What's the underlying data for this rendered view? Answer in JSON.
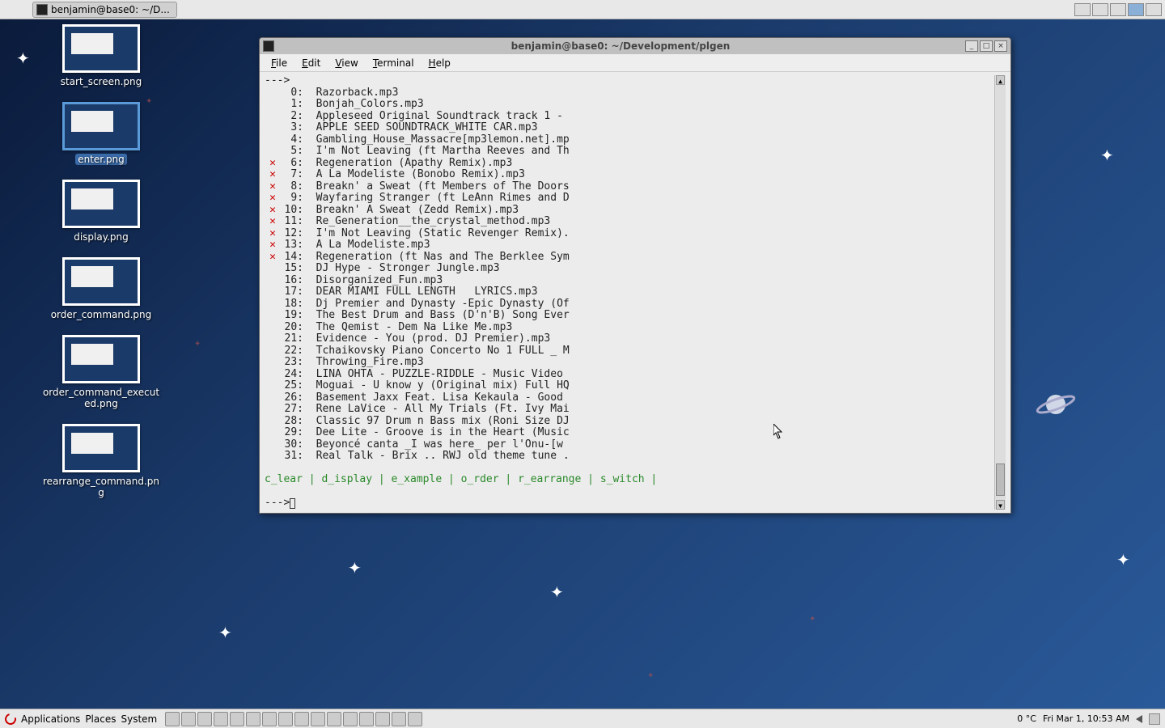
{
  "top_panel": {
    "task_label": "benjamin@base0: ~/D..."
  },
  "bottom_panel": {
    "menus": [
      "Applications",
      "Places",
      "System"
    ],
    "temp": "0 °C",
    "clock": "Fri Mar  1, 10:53 AM"
  },
  "desktop_icons": [
    {
      "label": "start_screen.png",
      "selected": false
    },
    {
      "label": "enter.png",
      "selected": true
    },
    {
      "label": "display.png",
      "selected": false
    },
    {
      "label": "order_command.png",
      "selected": false
    },
    {
      "label": "order_command_executed.png",
      "selected": false
    },
    {
      "label": "rearrange_command.png",
      "selected": false
    }
  ],
  "terminal": {
    "title": "benjamin@base0: ~/Development/plgen",
    "menus": [
      "File",
      "Edit",
      "View",
      "Terminal",
      "Help"
    ],
    "prompt": "--->",
    "tracks": [
      {
        "n": 0,
        "mark": false,
        "t": "Razorback.mp3"
      },
      {
        "n": 1,
        "mark": false,
        "t": "Bonjah_Colors.mp3"
      },
      {
        "n": 2,
        "mark": false,
        "t": "Appleseed Original Soundtrack track 1 -"
      },
      {
        "n": 3,
        "mark": false,
        "t": "APPLE SEED SOUNDTRACK_WHITE CAR.mp3"
      },
      {
        "n": 4,
        "mark": false,
        "t": "Gambling_House_Massacre[mp3lemon.net].mp"
      },
      {
        "n": 5,
        "mark": false,
        "t": "I'm Not Leaving (ft Martha Reeves and Th"
      },
      {
        "n": 6,
        "mark": true,
        "t": "Regeneration (Apathy Remix).mp3"
      },
      {
        "n": 7,
        "mark": true,
        "t": "A La Modeliste (Bonobo Remix).mp3"
      },
      {
        "n": 8,
        "mark": true,
        "t": "Breakn' a Sweat (ft Members of The Doors"
      },
      {
        "n": 9,
        "mark": true,
        "t": "Wayfaring Stranger (ft LeAnn Rimes and D"
      },
      {
        "n": 10,
        "mark": true,
        "t": "Breakn' A Sweat (Zedd Remix).mp3"
      },
      {
        "n": 11,
        "mark": true,
        "t": "Re_Generation__the_crystal_method.mp3"
      },
      {
        "n": 12,
        "mark": true,
        "t": "I'm Not Leaving (Static Revenger Remix)."
      },
      {
        "n": 13,
        "mark": true,
        "t": "A La Modeliste.mp3"
      },
      {
        "n": 14,
        "mark": true,
        "t": "Regeneration (ft Nas and The Berklee Sym"
      },
      {
        "n": 15,
        "mark": false,
        "t": "DJ Hype - Stronger Jungle.mp3"
      },
      {
        "n": 16,
        "mark": false,
        "t": "Disorganized_Fun.mp3"
      },
      {
        "n": 17,
        "mark": false,
        "t": "DEAR MIAMI FULL LENGTH   LYRICS.mp3"
      },
      {
        "n": 18,
        "mark": false,
        "t": "Dj Premier and Dynasty -Epic Dynasty (Of"
      },
      {
        "n": 19,
        "mark": false,
        "t": "The Best Drum and Bass (D'n'B) Song Ever"
      },
      {
        "n": 20,
        "mark": false,
        "t": "The Qemist - Dem Na Like Me.mp3"
      },
      {
        "n": 21,
        "mark": false,
        "t": "Evidence - You (prod. DJ Premier).mp3"
      },
      {
        "n": 22,
        "mark": false,
        "t": "Tchaikovsky Piano Concerto No 1 FULL _ M"
      },
      {
        "n": 23,
        "mark": false,
        "t": "Throwing_Fire.mp3"
      },
      {
        "n": 24,
        "mark": false,
        "t": "LINA OHTA - PUZZLE-RIDDLE - Music Video"
      },
      {
        "n": 25,
        "mark": false,
        "t": "Moguai - U know y (Original mix) Full HQ"
      },
      {
        "n": 26,
        "mark": false,
        "t": "Basement Jaxx Feat. Lisa Kekaula - Good"
      },
      {
        "n": 27,
        "mark": false,
        "t": "Rene LaVice - All My Trials (Ft. Ivy Mai"
      },
      {
        "n": 28,
        "mark": false,
        "t": "Classic 97 Drum n Bass mix (Roni Size DJ"
      },
      {
        "n": 29,
        "mark": false,
        "t": "Dee Lite - Groove is in the Heart (Music"
      },
      {
        "n": 30,
        "mark": false,
        "t": "Beyoncé canta _I was here_ per l'Onu-[w"
      },
      {
        "n": 31,
        "mark": false,
        "t": "Real Talk - Brix .. RWJ old theme tune ."
      }
    ],
    "commands": "c_lear | d_isplay | e_xample | o_rder | r_earrange | s_witch |"
  }
}
